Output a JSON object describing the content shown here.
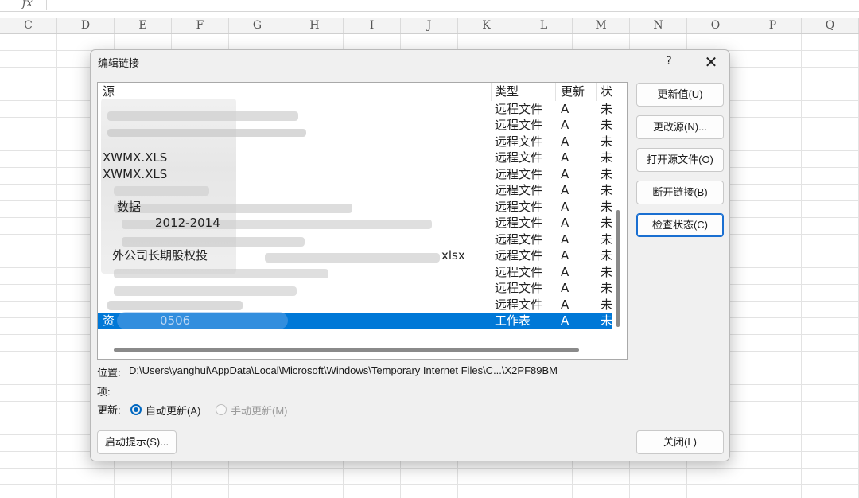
{
  "formula_bar": {
    "fx_label": "fx"
  },
  "columns": [
    "C",
    "D",
    "E",
    "F",
    "G",
    "H",
    "I",
    "J",
    "K",
    "L",
    "M",
    "N",
    "O",
    "P",
    "Q"
  ],
  "dialog": {
    "title": "编辑链接",
    "help": "?",
    "close": "✕",
    "headers": {
      "source": "源",
      "type": "类型",
      "update": "更新",
      "status": "状"
    },
    "rows": [
      {
        "source": "",
        "type": "远程文件",
        "update": "A",
        "status": "未",
        "selected": false
      },
      {
        "source": "",
        "type": "远程文件",
        "update": "A",
        "status": "未",
        "selected": false
      },
      {
        "source": "",
        "type": "远程文件",
        "update": "A",
        "status": "未",
        "selected": false
      },
      {
        "source": "XWMX.XLS",
        "type": "远程文件",
        "update": "A",
        "status": "未",
        "selected": false
      },
      {
        "source": "XWMX.XLS",
        "type": "远程文件",
        "update": "A",
        "status": "未",
        "selected": false
      },
      {
        "source": "",
        "type": "远程文件",
        "update": "A",
        "status": "未",
        "selected": false
      },
      {
        "source": "数据",
        "type": "远程文件",
        "update": "A",
        "status": "未",
        "selected": false
      },
      {
        "source": "2012-2014",
        "type": "远程文件",
        "update": "A",
        "status": "未",
        "selected": false
      },
      {
        "source": "",
        "type": "远程文件",
        "update": "A",
        "status": "未",
        "selected": false
      },
      {
        "source": "外公司长期股权投",
        "source_tail": "xlsx",
        "type": "远程文件",
        "update": "A",
        "status": "未",
        "selected": false
      },
      {
        "source": "",
        "type": "远程文件",
        "update": "A",
        "status": "未",
        "selected": false
      },
      {
        "source": "",
        "type": "远程文件",
        "update": "A",
        "status": "未",
        "selected": false
      },
      {
        "source": "",
        "type": "远程文件",
        "update": "A",
        "status": "未",
        "selected": false
      },
      {
        "source": "资",
        "source_tail": "0506",
        "type": "工作表",
        "update": "A",
        "status": "未",
        "selected": true
      }
    ],
    "buttons": {
      "update_values": "更新值(U)",
      "change_source": "更改源(N)...",
      "open_source": "打开源文件(O)",
      "break_link": "断开链接(B)",
      "check_status": "检查状态(C)",
      "startup_prompt": "启动提示(S)...",
      "close": "关闭(L)"
    },
    "location_label": "位置:",
    "location_value": "D:\\Users\\yanghui\\AppData\\Local\\Microsoft\\Windows\\Temporary Internet Files\\C...\\X2PF89BM",
    "item_label": "项:",
    "update_label": "更新:",
    "auto_update": "自动更新(A)",
    "manual_update": "手动更新(M)",
    "colors": {
      "accent": "#0078d7",
      "selection": "#0078d7",
      "radio": "#0067c0"
    }
  }
}
